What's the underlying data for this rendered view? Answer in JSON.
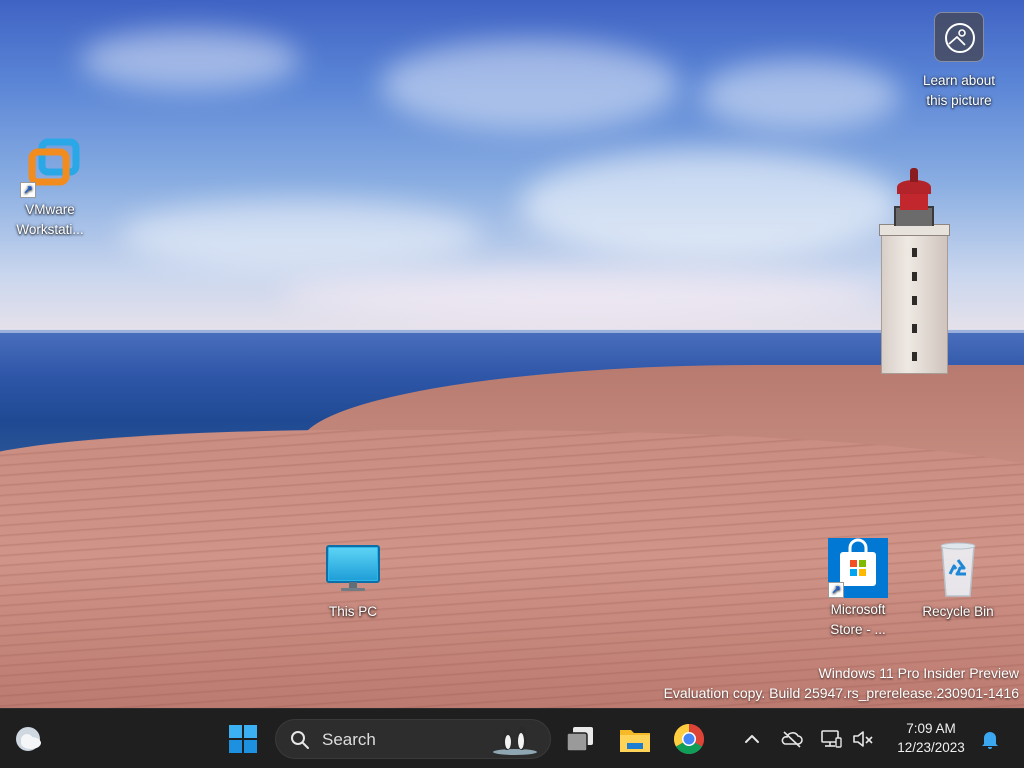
{
  "desktop": {
    "icons": [
      {
        "id": "vmware",
        "label": "VMware\nWorkstati..."
      },
      {
        "id": "this-pc",
        "label": "This PC"
      },
      {
        "id": "store",
        "label": "Microsoft\nStore - ..."
      },
      {
        "id": "recycle",
        "label": "Recycle Bin"
      }
    ],
    "learn_about_picture": {
      "label": "Learn about\nthis picture"
    },
    "watermark": {
      "line1": "Windows 11 Pro Insider Preview",
      "line2": "Evaluation copy. Build 25947.rs_prerelease.230901-1416"
    }
  },
  "taskbar": {
    "search": {
      "placeholder": "Search"
    },
    "clock": {
      "time": "7:09 AM",
      "date": "12/23/2023"
    },
    "pinned": [
      "start-icon",
      "task-view-icon",
      "file-explorer-icon",
      "chrome-icon"
    ],
    "tray": [
      "chevron-up-icon",
      "onedrive-offline-icon",
      "network-icon",
      "volume-muted-icon",
      "notification-bell-icon"
    ]
  },
  "colors": {
    "taskbar_bg": "#1f1f1f",
    "accent_blue": "#0078d4"
  }
}
